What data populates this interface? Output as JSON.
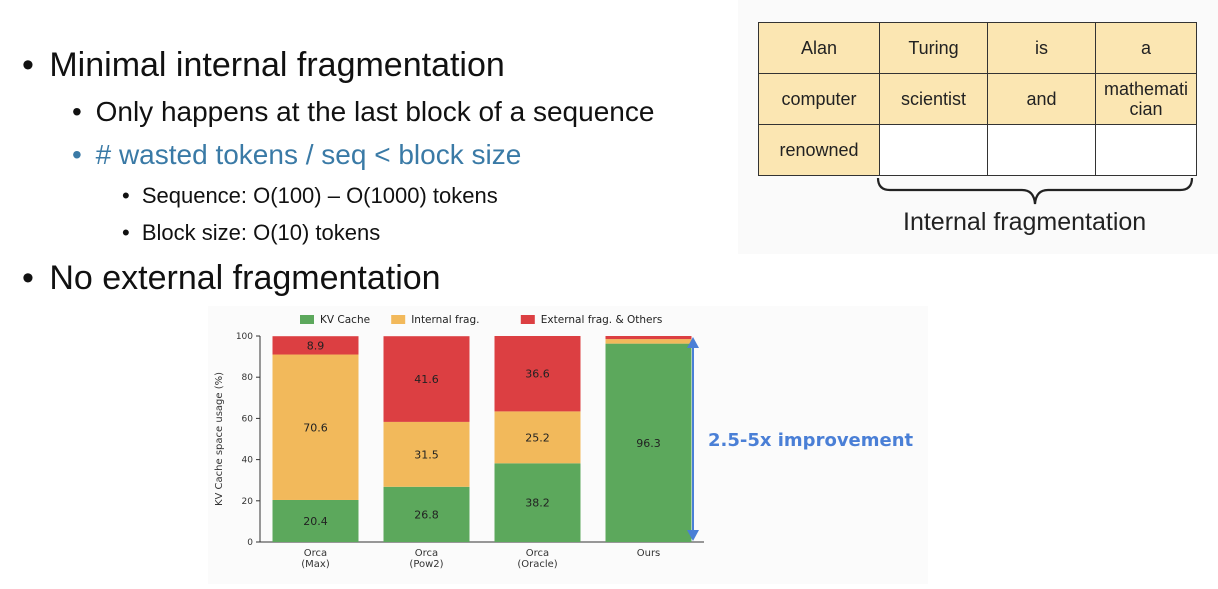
{
  "bullets": {
    "b1": "Minimal internal fragmentation",
    "b1_1": "Only happens at the last block of a sequence",
    "b1_2": "# wasted tokens / seq < block size",
    "b1_2_1": "Sequence: O(100) – O(1000) tokens",
    "b1_2_2": "Block size: O(10) tokens",
    "b2": "No external fragmentation",
    "dot": "•"
  },
  "token_table": {
    "rows": [
      [
        "Alan",
        "Turing",
        "is",
        "a"
      ],
      [
        "computer",
        "scientist",
        "and",
        "mathemati\ncian"
      ],
      [
        "renowned",
        "",
        "",
        ""
      ]
    ],
    "label": "Internal fragmentation",
    "fill_color": "#fbe6b2"
  },
  "chart_data": {
    "type": "bar",
    "stacked": true,
    "ylabel": "KV Cache space usage (%)",
    "ylim": [
      0,
      100
    ],
    "yticks": [
      0,
      20,
      40,
      60,
      80,
      100
    ],
    "categories": [
      "Orca\n(Max)",
      "Orca\n(Pow2)",
      "Orca\n(Oracle)",
      "Ours"
    ],
    "series": [
      {
        "name": "KV Cache",
        "color": "#5ca85c",
        "values": [
          20.4,
          26.8,
          38.2,
          96.3
        ],
        "labels": [
          "20.4",
          "26.8",
          "38.2",
          "96.3"
        ]
      },
      {
        "name": "Internal frag.",
        "color": "#f2b95b",
        "values": [
          70.6,
          31.5,
          25.2,
          2.2
        ],
        "labels": [
          "70.6",
          "31.5",
          "25.2",
          ""
        ]
      },
      {
        "name": "External frag. & Others",
        "color": "#dc3f42",
        "values": [
          8.9,
          41.6,
          36.6,
          1.5
        ],
        "labels": [
          "8.9",
          "41.6",
          "36.6",
          ""
        ]
      }
    ],
    "legend_position": "top",
    "annotation": "2.5-5x improvement",
    "annotation_color": "#4a7fd6"
  }
}
